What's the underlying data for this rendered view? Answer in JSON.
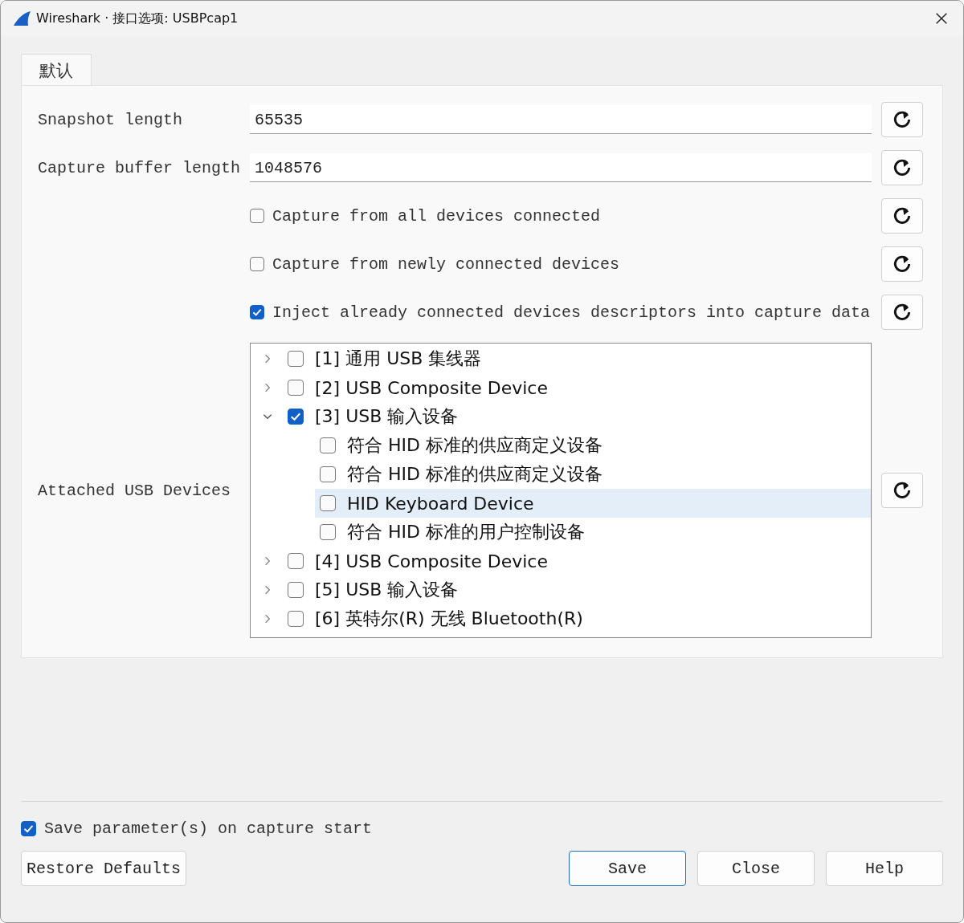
{
  "window": {
    "title": "Wireshark · 接口选项: USBPcap1"
  },
  "tabs": [
    {
      "label": "默认",
      "selected": true
    }
  ],
  "options": [
    {
      "kind": "field",
      "label": "Snapshot length",
      "value": "65535"
    },
    {
      "kind": "field",
      "label": "Capture buffer length",
      "value": "1048576"
    },
    {
      "kind": "checkbox",
      "label": "Capture from all devices connected",
      "checked": false
    },
    {
      "kind": "checkbox",
      "label": "Capture from newly connected devices",
      "checked": false
    },
    {
      "kind": "checkbox",
      "label": "Inject already connected devices descriptors into capture data",
      "checked": true
    },
    {
      "kind": "tree",
      "label": "Attached USB Devices",
      "items": [
        {
          "label": "[1] 通用 USB 集线器",
          "checked": false,
          "expanded": false,
          "selected": false
        },
        {
          "label": "[2] USB Composite Device",
          "checked": false,
          "expanded": false,
          "selected": false
        },
        {
          "label": "[3] USB 输入设备",
          "checked": true,
          "expanded": true,
          "selected": false,
          "children": [
            {
              "label": "符合 HID 标准的供应商定义设备",
              "checked": false,
              "selected": false
            },
            {
              "label": "符合 HID 标准的供应商定义设备",
              "checked": false,
              "selected": false
            },
            {
              "label": "HID Keyboard Device",
              "checked": false,
              "selected": true
            },
            {
              "label": "符合 HID 标准的用户控制设备",
              "checked": false,
              "selected": false
            }
          ]
        },
        {
          "label": "[4] USB Composite Device",
          "checked": false,
          "expanded": false,
          "selected": false
        },
        {
          "label": "[5] USB 输入设备",
          "checked": false,
          "expanded": false,
          "selected": false
        },
        {
          "label": "[6] 英特尔(R) 无线 Bluetooth(R)",
          "checked": false,
          "expanded": false,
          "selected": false
        }
      ]
    }
  ],
  "save_on_start": {
    "label": "Save parameter(s) on capture start",
    "checked": true
  },
  "buttons": [
    {
      "label": "Restore Defaults",
      "kind": "left"
    },
    {
      "label": "Save",
      "kind": "default"
    },
    {
      "label": "Close",
      "kind": "normal"
    },
    {
      "label": "Help",
      "kind": "normal"
    }
  ]
}
